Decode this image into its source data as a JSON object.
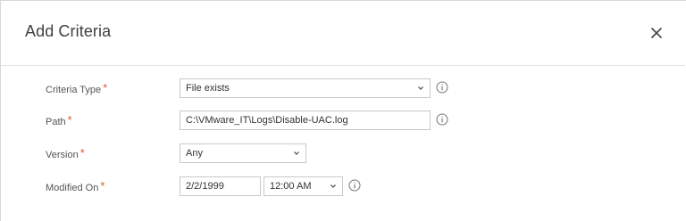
{
  "dialog": {
    "title": "Add Criteria",
    "close_icon": "close-icon"
  },
  "form": {
    "criteria_type": {
      "label": "Criteria Type",
      "required_mark": "*",
      "value": "File exists"
    },
    "path": {
      "label": "Path",
      "required_mark": "*",
      "value": "C:\\VMware_IT\\Logs\\Disable-UAC.log"
    },
    "version": {
      "label": "Version",
      "required_mark": "*",
      "value": "Any"
    },
    "modified_on": {
      "label": "Modified On",
      "required_mark": "*",
      "date": "2/2/1999",
      "time": "12:00 AM"
    }
  },
  "colors": {
    "required": "#e05a2b",
    "border": "#c8c8c8"
  }
}
